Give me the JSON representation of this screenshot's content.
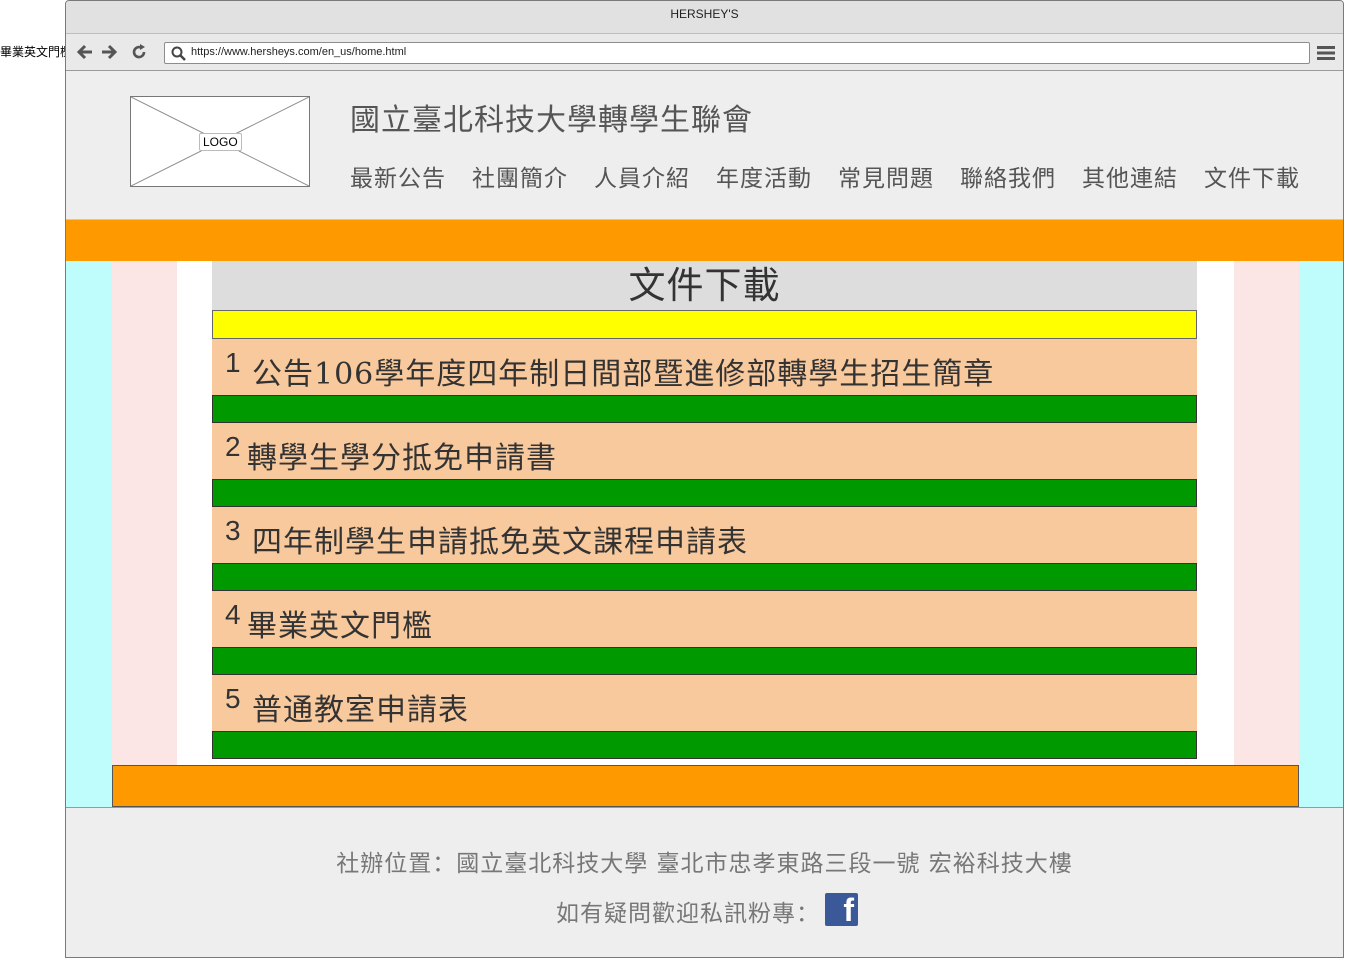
{
  "outside_label": "畢業英文門檻",
  "window": {
    "title": "HERSHEY'S"
  },
  "browser": {
    "url": "https://www.hersheys.com/en_us/home.html"
  },
  "header": {
    "logo_text": "LOGO",
    "site_title": "國立臺北科技大學轉學生聯會",
    "nav": [
      "最新公告",
      "社團簡介",
      "人員介紹",
      "年度活動",
      "常見問題",
      "聯絡我們",
      "其他連結",
      "文件下載"
    ]
  },
  "main": {
    "heading": "文件下載",
    "documents": [
      {
        "num": "1",
        "title": "公告106學年度四年制日間部暨進修部轉學生招生簡章"
      },
      {
        "num": "2",
        "title": "轉學生學分抵免申請書"
      },
      {
        "num": "3",
        "title": "四年制學生申請抵免英文課程申請表"
      },
      {
        "num": "4",
        "title": "畢業英文門檻"
      },
      {
        "num": "5",
        "title": "普通教室申請表"
      }
    ]
  },
  "footer": {
    "location": "社辦位置：國立臺北科技大學  臺北市忠孝東路三段一號  宏裕科技大樓",
    "contact": "如有疑問歡迎私訊粉專：",
    "facebook_icon": "facebook-icon"
  },
  "colors": {
    "orange": "#ff9900",
    "yellow": "#ffff00",
    "green": "#009900",
    "peach": "#f8c99c",
    "cyan": "#bffdfd",
    "pink": "#fbe5e5",
    "facebook": "#3b5998"
  }
}
